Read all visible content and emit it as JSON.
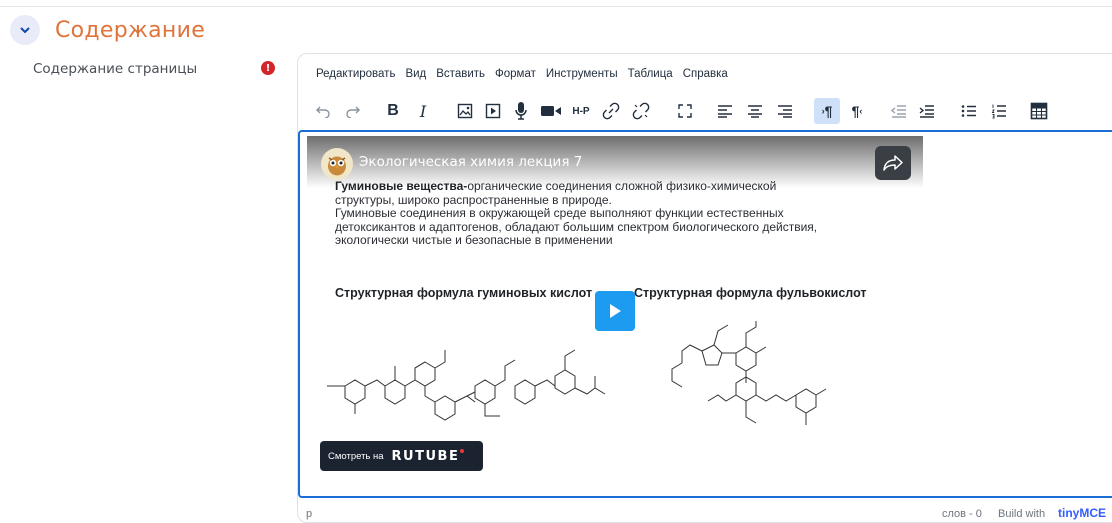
{
  "section": {
    "title": "Содержание",
    "toggle_icon": "chevron-down-icon",
    "accent_color": "#e0733a"
  },
  "field": {
    "label": "Содержание страницы",
    "required_icon": "required-exclamation-icon"
  },
  "editor": {
    "menu": [
      "Редактировать",
      "Вид",
      "Вставить",
      "Формат",
      "Инструменты",
      "Таблица",
      "Справка"
    ],
    "toolbar_icons": [
      "undo-icon",
      "redo-icon",
      "bold-icon",
      "italic-icon",
      "image-icon",
      "media-icon",
      "audio-record-icon",
      "video-record-icon",
      "h5p-icon",
      "link-icon",
      "unlink-icon",
      "fullscreen-icon",
      "align-left-icon",
      "align-center-icon",
      "align-right-icon",
      "ltr-icon",
      "rtl-icon",
      "outdent-icon",
      "indent-icon",
      "bullet-list-icon",
      "numbered-list-icon",
      "table-icon"
    ],
    "toolbar": {
      "bold": "B",
      "italic": "I",
      "h5p": "H-P",
      "ltr": "¶",
      "rtl": "¶"
    },
    "video": {
      "title": "Экологическая химия лекция 7",
      "slide_heading": "Гуминовые вещества-",
      "slide_line1_rest": "органические соединения сложной физико-химической",
      "slide_line2": "структуры, широко распространенные в природе.",
      "slide_line3": "Гуминовые соединения в окружающей среде выполняют функции естественных",
      "slide_line4": "детоксикантов и адаптогенов, обладают большим спектром биологического действия,",
      "slide_line5": "экологически чистые и безопасные в применении",
      "formula_left": "Структурная формула гуминовых кислот",
      "formula_right": "Структурная формула фульвокислот",
      "watch_label": "Смотреть на",
      "watch_brand": "RUTUBE"
    },
    "status": {
      "path": "p",
      "words": "слов - 0",
      "build": "Build with",
      "brand": "tinyMCE"
    }
  }
}
